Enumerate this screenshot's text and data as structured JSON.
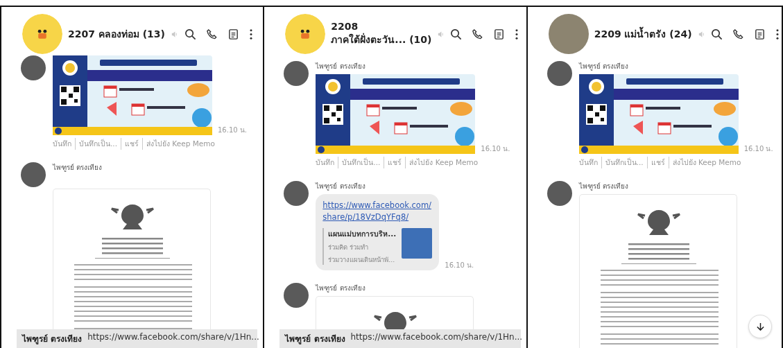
{
  "panels": [
    {
      "header": {
        "avatar": {
          "kind": "mascot"
        },
        "title_lines": [
          "2207 คลองท่อม (13)"
        ]
      },
      "messages": [
        {
          "kind": "image",
          "time": "16.10 น.",
          "actions": [
            "บันทึก",
            "บันทึกเป็น...",
            "แชร์",
            "ส่งไปยัง Keep Memo"
          ]
        },
        {
          "kind": "document",
          "sender": "ไพฑูรย์ ตรงเทียง"
        }
      ],
      "preview": {
        "sender": "ไพฑูรย์ ตรงเทียง",
        "text": "https://www.facebook.com/share/v/1Hn..."
      }
    },
    {
      "header": {
        "avatar": {
          "kind": "mascot"
        },
        "title_lines": [
          "2208",
          "ภาคใต้ฝั่งตะวัน... (10)"
        ]
      },
      "messages": [
        {
          "kind": "image",
          "sender": "ไพฑูรย์ ตรงเทียง",
          "time": "16.10 น.",
          "actions": [
            "บันทึก",
            "บันทึกเป็น...",
            "แชร์",
            "ส่งไปยัง Keep Memo"
          ]
        },
        {
          "kind": "link",
          "sender": "ไพฑูรย์ ตรงเทียง",
          "time": "16.10 น.",
          "url_lines": [
            "https://www.facebook.com/",
            "share/p/18VzDqYFq8/"
          ],
          "card": {
            "title": "แผนแม่บทการบริห...",
            "lines": [
              "ร่วมคิด ร่วมทำ",
              "ร่วมวางแผนเดินหน้าพั..."
            ]
          }
        },
        {
          "kind": "document",
          "sender": "ไพฑูรย์ ตรงเทียง"
        }
      ],
      "preview": {
        "sender": "ไพฑูรย์ ตรงเทียง",
        "text": "https://www.facebook.com/share/v/1Hn..."
      }
    },
    {
      "header": {
        "avatar": {
          "kind": "photo"
        },
        "title_lines": [
          "2209 แม่น้ำตรัง (24)"
        ]
      },
      "messages": [
        {
          "kind": "image",
          "sender": "ไพฑูรย์ ตรงเทียง",
          "time": "16.10 น.",
          "actions": [
            "บันทึก",
            "บันทึกเป็น...",
            "แชร์",
            "ส่งไปยัง Keep Memo"
          ]
        },
        {
          "kind": "document",
          "sender": "ไพฑูรย์ ตรงเทียง"
        }
      ],
      "scroll_down_button": true
    }
  ]
}
